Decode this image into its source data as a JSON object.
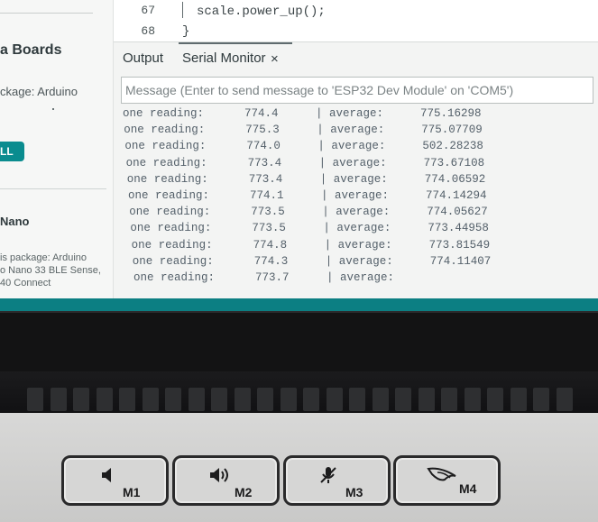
{
  "sidebar": {
    "title": "a Boards",
    "package": "ckage: Arduino",
    "install_button": "LL",
    "board_name": "Nano",
    "desc_lines": [
      "is package: Arduino",
      "o Nano 33 BLE Sense,",
      "40 Connect"
    ]
  },
  "editor": {
    "lines": [
      {
        "num": "67",
        "code": "scale.power_up();"
      },
      {
        "num": "68",
        "code": "}"
      }
    ]
  },
  "panel": {
    "tabs": [
      {
        "label": "Output"
      },
      {
        "label": "Serial Monitor"
      }
    ],
    "close_symbol": "×",
    "message_placeholder": "Message (Enter to send message to 'ESP32 Dev Module' on 'COM5')"
  },
  "serial_output": [
    {
      "label": "one reading:",
      "reading": "774.4",
      "avg_label": "| average:",
      "average": "775.16298"
    },
    {
      "label": "one reading:",
      "reading": "775.3",
      "avg_label": "| average:",
      "average": "775.07709"
    },
    {
      "label": "one reading:",
      "reading": "774.0",
      "avg_label": "| average:",
      "average": "502.28238"
    },
    {
      "label": "one reading:",
      "reading": "773.4",
      "avg_label": "| average:",
      "average": "773.67108"
    },
    {
      "label": "one reading:",
      "reading": "773.4",
      "avg_label": "| average:",
      "average": "774.06592"
    },
    {
      "label": "one reading:",
      "reading": "774.1",
      "avg_label": "| average:",
      "average": "774.14294"
    },
    {
      "label": "one reading:",
      "reading": "773.5",
      "avg_label": "| average:",
      "average": "774.05627"
    },
    {
      "label": "one reading:",
      "reading": "773.5",
      "avg_label": "| average:",
      "average": "773.44958"
    },
    {
      "label": "one reading:",
      "reading": "774.8",
      "avg_label": "| average:",
      "average": "773.81549"
    },
    {
      "label": "one reading:",
      "reading": "774.3",
      "avg_label": "| average:",
      "average": "774.11407"
    },
    {
      "label": "one reading:",
      "reading": "773.7",
      "avg_label": "| average:",
      "average": ""
    }
  ],
  "keyboard": {
    "keys": [
      {
        "label": "M1",
        "icon": "speaker-mute-icon"
      },
      {
        "label": "M2",
        "icon": "speaker-volume-icon"
      },
      {
        "label": "M3",
        "icon": "mic-mute-icon"
      },
      {
        "label": "M4",
        "icon": "rog-logo-icon"
      }
    ]
  },
  "colors": {
    "accent_teal": "#0c7f83",
    "install_button": "#0a8c8f",
    "code_function": "#c16a2c"
  }
}
